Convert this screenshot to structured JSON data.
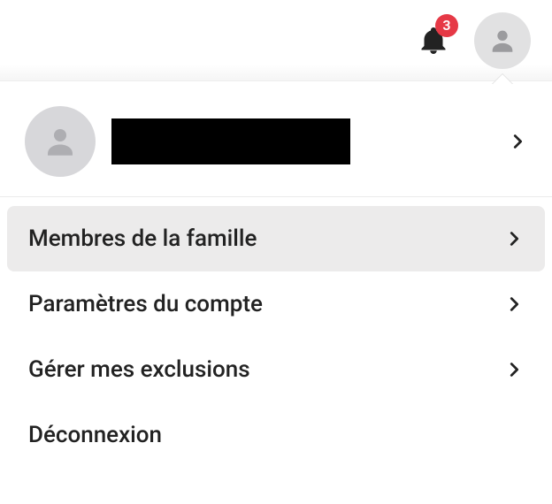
{
  "header": {
    "notification_count": "3"
  },
  "profile": {
    "name_redacted": " "
  },
  "menu": {
    "items": [
      {
        "label": "Membres de la famille",
        "selected": true,
        "chevron": true
      },
      {
        "label": "Paramètres du compte",
        "selected": false,
        "chevron": true
      },
      {
        "label": "Gérer mes exclusions",
        "selected": false,
        "chevron": true
      },
      {
        "label": "Déconnexion",
        "selected": false,
        "chevron": false
      }
    ]
  }
}
